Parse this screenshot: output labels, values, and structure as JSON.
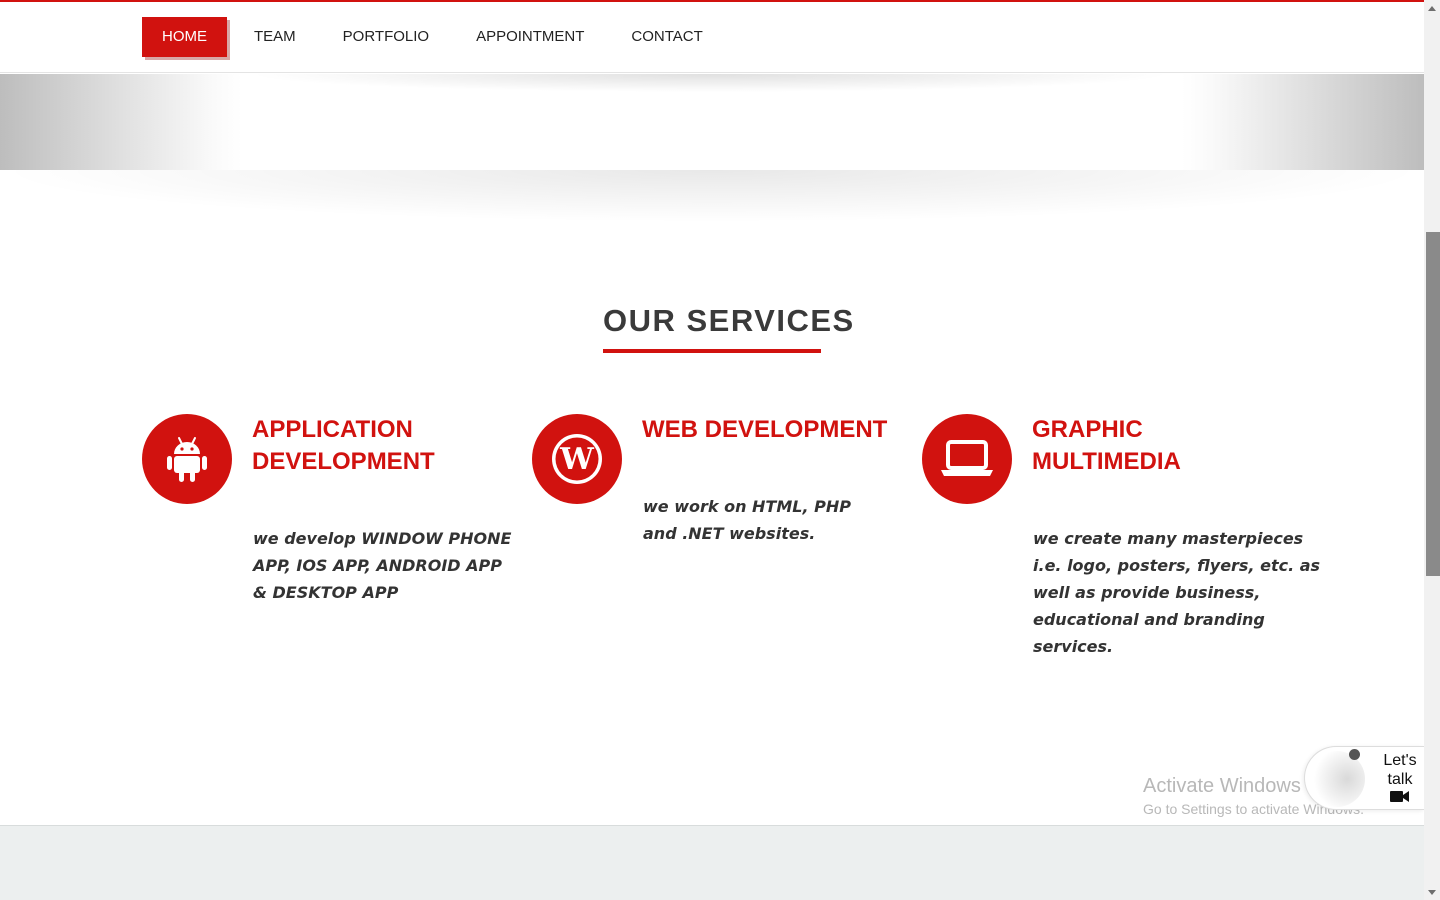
{
  "nav": {
    "items": [
      {
        "label": "HOME",
        "active": true
      },
      {
        "label": "TEAM",
        "active": false
      },
      {
        "label": "PORTFOLIO",
        "active": false
      },
      {
        "label": "APPOINTMENT",
        "active": false
      },
      {
        "label": "CONTACT",
        "active": false
      }
    ]
  },
  "services": {
    "title": "OUR SERVICES",
    "items": [
      {
        "icon": "android-icon",
        "title_line1": "APPLICATION",
        "title_line2": "DEVELOPMENT",
        "desc_lines": [
          "we develop WINDOW PHONE",
          "APP, IOS APP, ANDROID APP",
          "& DESKTOP APP"
        ]
      },
      {
        "icon": "wordpress-icon",
        "title_line1": "WEB DEVELOPMENT",
        "title_line2": "",
        "desc_lines": [
          "we work on HTML, PHP",
          "and .NET websites."
        ]
      },
      {
        "icon": "laptop-icon",
        "title_line1": "GRAPHIC",
        "title_line2": "MULTIMEDIA",
        "desc_lines": [
          "we create many masterpieces",
          "i.e. logo, posters, flyers, etc. as",
          "well as provide business,",
          "educational and branding",
          "services."
        ]
      }
    ]
  },
  "chat_widget": {
    "line1": "Let's",
    "line2": "talk",
    "icon": "video-camera-icon"
  },
  "watermark": {
    "title": "Activate Windows",
    "subtitle": "Go to Settings to activate Windows."
  },
  "colors": {
    "accent": "#d1120f",
    "text": "#333333",
    "footer_band": "#ecefef"
  }
}
